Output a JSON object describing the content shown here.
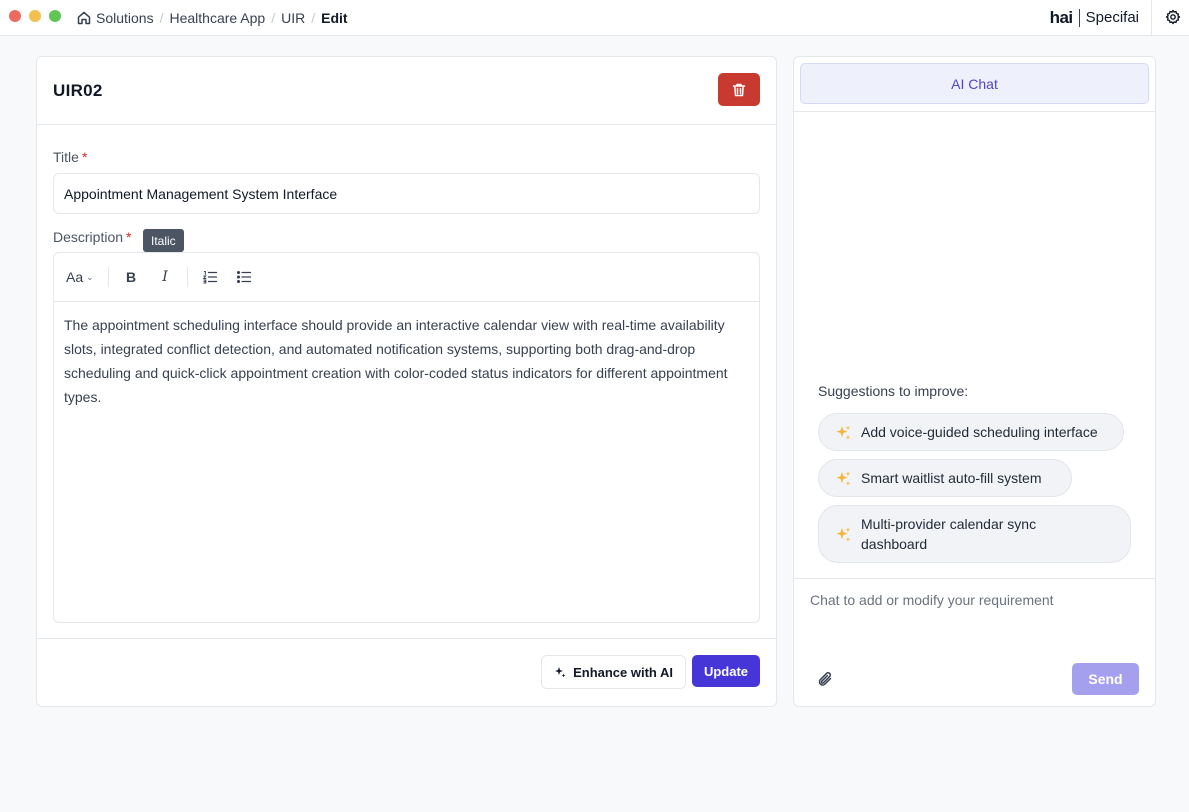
{
  "breadcrumb": {
    "items": [
      "Solutions",
      "Healthcare App",
      "UIR"
    ],
    "current": "Edit"
  },
  "brand": {
    "logo": "hai",
    "name": "Specifai"
  },
  "requirement": {
    "id": "UIR02",
    "title_label": "Title",
    "title_value": "Appointment Management System Interface",
    "description_label": "Description",
    "required_marker": "*",
    "tooltip": "Italic",
    "toolbar": {
      "font_size_label": "Aa",
      "bold_label": "B",
      "italic_label": "I"
    },
    "description_value": "The appointment scheduling interface should provide an interactive calendar view with real-time availability slots, integrated conflict detection, and automated notification systems, supporting both drag-and-drop scheduling and quick-click appointment creation with color-coded status indicators for different appointment types.",
    "enhance_label": "Enhance with AI",
    "update_label": "Update"
  },
  "chat": {
    "tab_label": "AI Chat",
    "suggestions_title": "Suggestions to improve:",
    "suggestions": [
      "Add voice-guided scheduling interface",
      "Smart waitlist auto-fill system",
      "Multi-provider calendar sync dashboard"
    ],
    "input_placeholder": "Chat to add or modify your requirement",
    "send_label": "Send"
  },
  "colors": {
    "primary": "#4636d8",
    "danger": "#c83a30",
    "send_disabled": "#a5a0ee",
    "sparkle": "#f4b63a"
  },
  "icons": [
    "home-icon",
    "settings-icon",
    "trash-icon",
    "sparkle-icon",
    "ordered-list-icon",
    "bullet-list-icon",
    "paperclip-icon"
  ]
}
